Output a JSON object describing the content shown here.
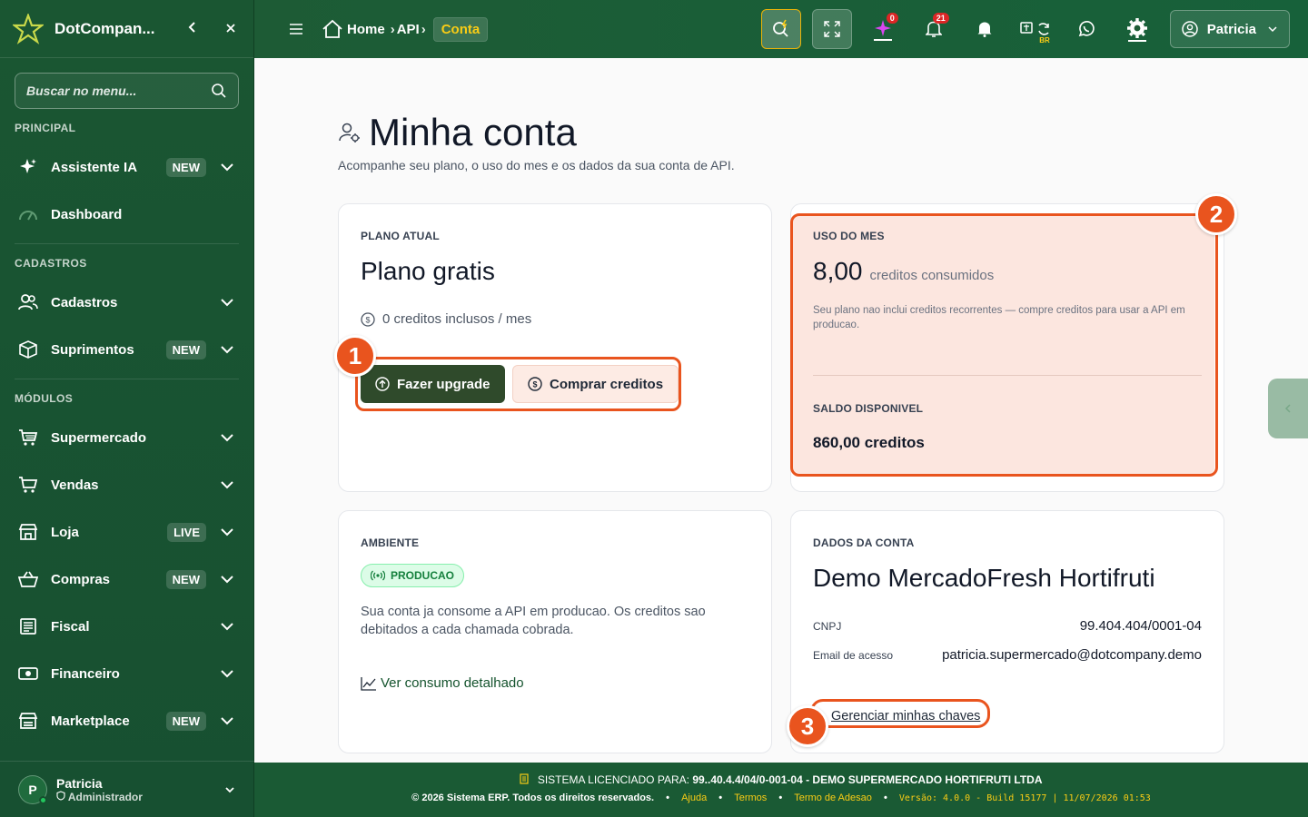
{
  "sidebar": {
    "brand": "DotCompan...",
    "search_placeholder": "Buscar no menu...",
    "sections": {
      "principal": "PRINCIPAL",
      "cadastros": "CADASTROS",
      "modulos": "MÓDULOS"
    },
    "items": {
      "assistente": {
        "label": "Assistente IA",
        "badge": "NEW"
      },
      "dashboard": {
        "label": "Dashboard"
      },
      "cadastros": {
        "label": "Cadastros"
      },
      "suprimentos": {
        "label": "Suprimentos",
        "badge": "NEW"
      },
      "supermercado": {
        "label": "Supermercado"
      },
      "vendas": {
        "label": "Vendas"
      },
      "loja": {
        "label": "Loja",
        "badge": "LIVE"
      },
      "compras": {
        "label": "Compras",
        "badge": "NEW"
      },
      "fiscal": {
        "label": "Fiscal"
      },
      "financeiro": {
        "label": "Financeiro"
      },
      "marketplace": {
        "label": "Marketplace",
        "badge": "NEW"
      }
    },
    "user": {
      "name": "Patricia",
      "role": "Administrador",
      "initial": "P"
    }
  },
  "header": {
    "breadcrumb": {
      "home": "Home",
      "api": "API",
      "current": "Conta"
    },
    "ai_badge": "0",
    "notif_badge": "21",
    "lang_label": "BR",
    "user_button": "Patricia"
  },
  "page": {
    "title": "Minha conta",
    "subtitle": "Acompanhe seu plano, o uso do mes e os dados da sua conta de API."
  },
  "plan_card": {
    "label": "PLANO ATUAL",
    "name": "Plano gratis",
    "credits_included": "0 creditos inclusos / mes",
    "upgrade_button": "Fazer upgrade",
    "buy_button": "Comprar creditos"
  },
  "usage_card": {
    "label": "USO DO MES",
    "value": "8,00",
    "unit": "creditos consumidos",
    "note": "Seu plano nao inclui creditos recorrentes — compre creditos para usar a API em producao.",
    "balance_label": "SALDO DISPONIVEL",
    "balance_value": "860,00 creditos"
  },
  "env_card": {
    "label": "AMBIENTE",
    "pill": "PRODUCAO",
    "text": "Sua conta ja consome a API em producao. Os creditos sao debitados a cada chamada cobrada.",
    "link": "Ver consumo detalhado"
  },
  "account_card": {
    "label": "DADOS DA CONTA",
    "company": "Demo MercadoFresh Hortifruti",
    "cnpj_label": "CNPJ",
    "cnpj_value": "99.404.404/0001-04",
    "email_label": "Email de acesso",
    "email_value": "patricia.supermercado@dotcompany.demo",
    "keys_link": "Gerenciar minhas chaves"
  },
  "annotations": {
    "n1": "1",
    "n2": "2",
    "n3": "3"
  },
  "footer": {
    "license_prefix": "SISTEMA LICENCIADO PARA:",
    "license_value": "99..40.4.4/04/0-001-04 - DEMO SUPERMERCADO HORTIFRUTI LTDA",
    "copyright": "© 2026 Sistema ERP. Todos os direitos reservados.",
    "help": "Ajuda",
    "terms": "Termos",
    "adhesion": "Termo de Adesao",
    "version": "Versão: 4.0.0 - Build 15177 | 11/07/2026 01:53"
  },
  "colors": {
    "sidebar": "#175031",
    "highlight": "#e9541e",
    "accent_yellow": "#facc15"
  }
}
